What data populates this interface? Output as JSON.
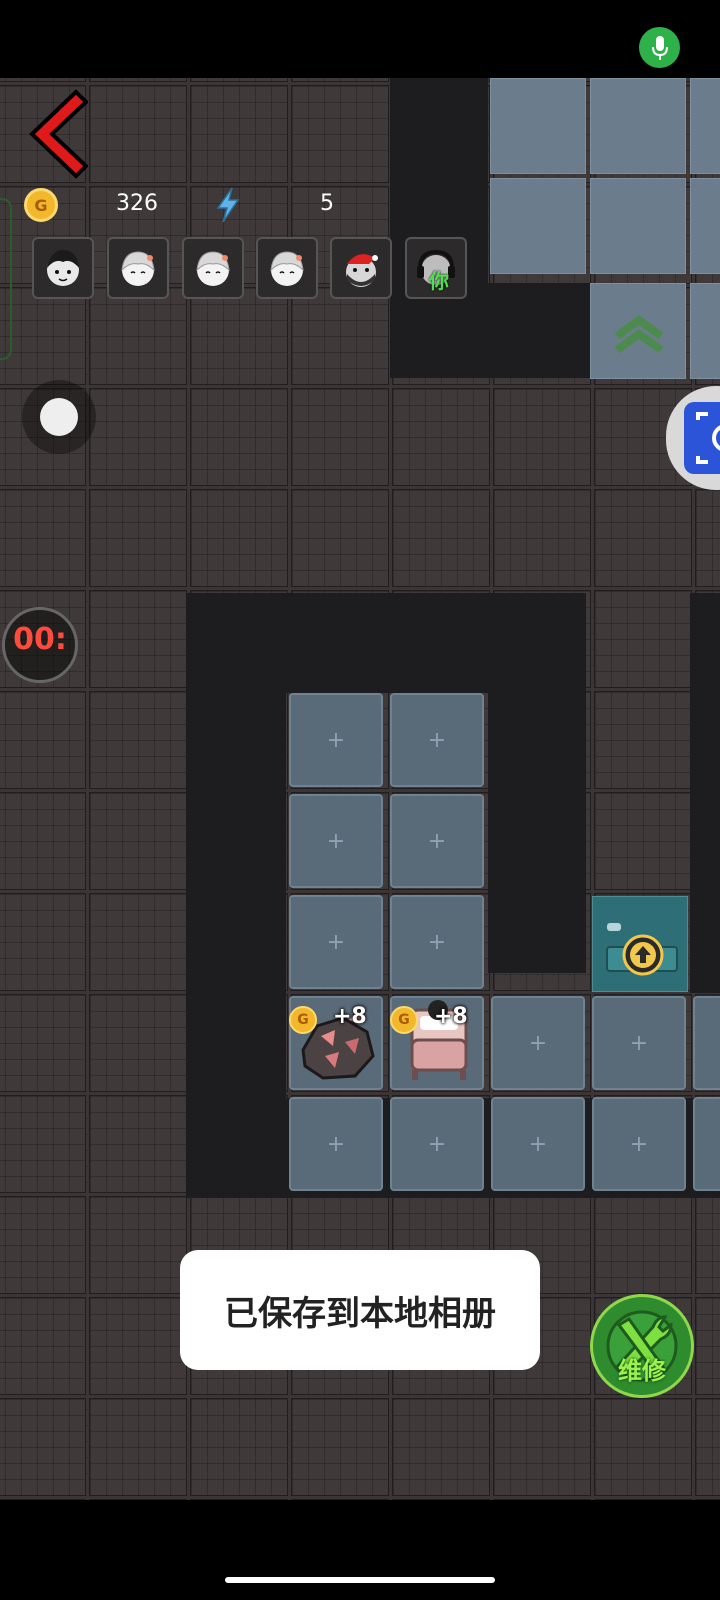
{
  "hud": {
    "coins": "326",
    "energy": "5",
    "timer": "00:",
    "coin_symbol": "G"
  },
  "items": [
    {
      "name": "ore",
      "reward": "+8"
    },
    {
      "name": "bed",
      "reward": "+8"
    }
  ],
  "avatars": [
    {
      "name": "black-haired girl"
    },
    {
      "name": "white-haired granny"
    },
    {
      "name": "white-haired granny"
    },
    {
      "name": "white-haired granny"
    },
    {
      "name": "santa ghost"
    },
    {
      "name": "you-marker",
      "label": "你"
    }
  ],
  "toast": {
    "text": "已保存到本地相册"
  },
  "repair_button": {
    "label": "维修"
  },
  "empty_slot_symbol": "+",
  "colors": {
    "accent_green": "#2fb14a",
    "coin_gold": "#f3b72b",
    "timer_red": "#ff4b3e",
    "camera_blue": "#2c54d9"
  }
}
